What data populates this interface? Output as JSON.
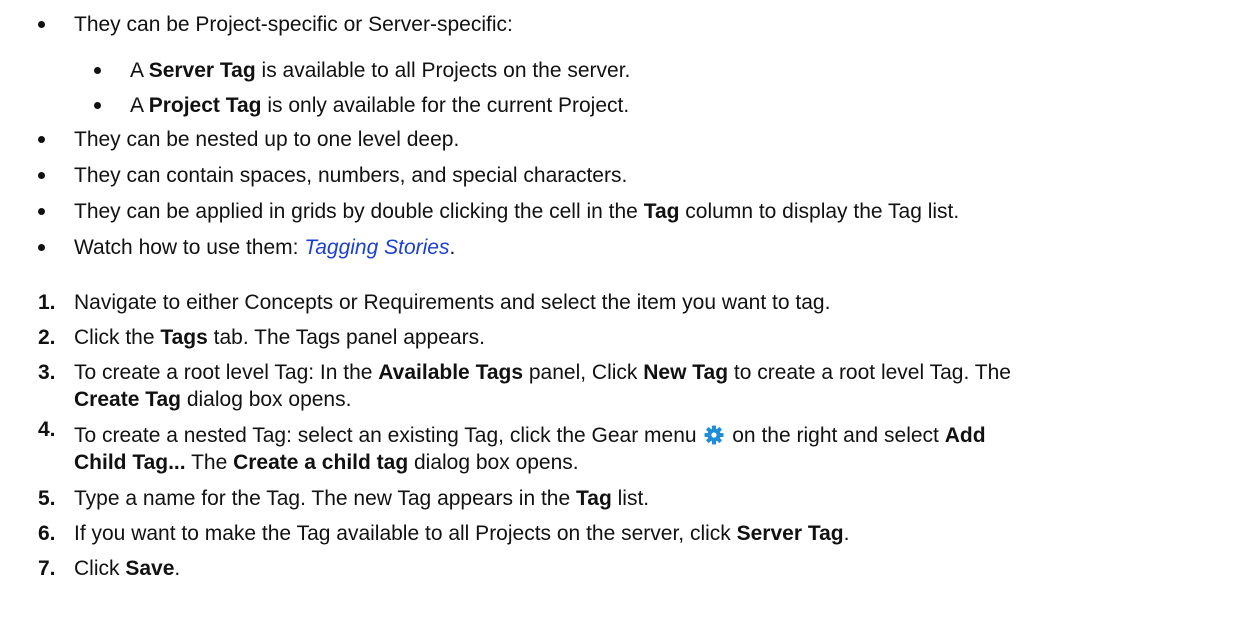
{
  "bullets": {
    "b1": "They can be Project-specific or Server-specific:",
    "b1a": {
      "pre": "A ",
      "bold": "Server Tag",
      "post": " is available to all Projects on the server."
    },
    "b1b": {
      "pre": "A ",
      "bold": "Project Tag",
      "post": " is only available for the current Project."
    },
    "b2": "They can be nested up to one level deep.",
    "b3": "They can contain spaces, numbers, and special characters.",
    "b4": {
      "pre": "They can be applied in grids by double clicking the cell in the ",
      "bold": "Tag",
      "post": " column to display the Tag list."
    },
    "b5": {
      "pre": "Watch how to use them: ",
      "link": "Tagging Stories",
      "post": "."
    }
  },
  "steps": {
    "s1": {
      "num": "1.",
      "text": "Navigate to either Concepts or Requirements and select the item you want to tag."
    },
    "s2": {
      "num": "2.",
      "pre": "Click the ",
      "bold": "Tags",
      "post": " tab. The Tags panel appears."
    },
    "s3": {
      "num": "3.",
      "p1": "To create a root level Tag: In the ",
      "b1": "Available Tags",
      "p2": " panel, Click ",
      "b2": "New Tag",
      "p3": " to create a root level Tag. The",
      "b3": "Create Tag",
      "p4": " dialog box opens."
    },
    "s4": {
      "num": "4.",
      "p1": "To create a nested Tag: select an existing Tag, click the Gear menu ",
      "p2": " on the right and select ",
      "b1": "Add",
      "b2": "Child Tag...",
      "p3": " The ",
      "b3": "Create a child tag",
      "p4": " dialog box opens."
    },
    "s5": {
      "num": "5.",
      "pre": "Type a name for the Tag. The new Tag appears in the ",
      "bold": "Tag",
      "post": " list."
    },
    "s6": {
      "num": "6.",
      "pre": "If you want to make the Tag available to all Projects on the server, click ",
      "bold": "Server Tag",
      "post": "."
    },
    "s7": {
      "num": "7.",
      "pre": "Click ",
      "bold": "Save",
      "post": "."
    }
  },
  "icons": {
    "gear": "gear-icon",
    "gear_color": "#1e8fd6"
  },
  "colors": {
    "text": "#111111",
    "link": "#1a3fd1"
  }
}
